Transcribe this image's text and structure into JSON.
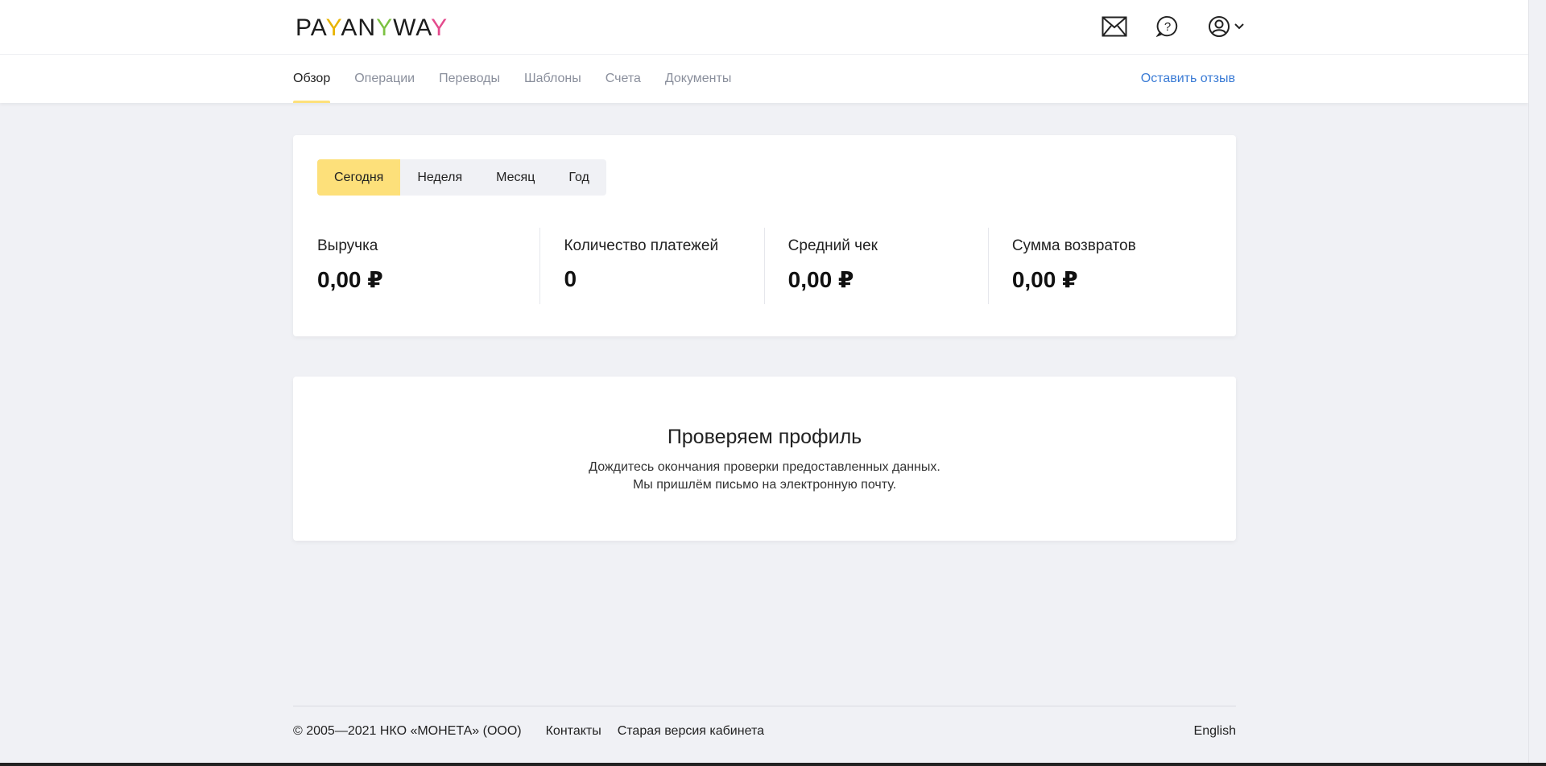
{
  "logo": {
    "part1": "PA",
    "y1": "Y",
    "part2": "AN",
    "y2": "Y",
    "part3": "WA",
    "y3": "Y"
  },
  "header_icons": [
    "mail-icon",
    "help-icon",
    "user-icon",
    "chevron-down-icon"
  ],
  "nav": {
    "items": [
      {
        "label": "Обзор",
        "active": true
      },
      {
        "label": "Операции"
      },
      {
        "label": "Переводы"
      },
      {
        "label": "Шаблоны"
      },
      {
        "label": "Счета"
      },
      {
        "label": "Документы"
      }
    ],
    "feedback": "Оставить отзыв"
  },
  "period_tabs": [
    {
      "label": "Сегодня",
      "active": true
    },
    {
      "label": "Неделя"
    },
    {
      "label": "Месяц"
    },
    {
      "label": "Год"
    }
  ],
  "metrics": [
    {
      "label": "Выручка",
      "value": "0,00 ₽"
    },
    {
      "label": "Количество платежей",
      "value": "0"
    },
    {
      "label": "Средний чек",
      "value": "0,00 ₽"
    },
    {
      "label": "Сумма возвратов",
      "value": "0,00 ₽"
    }
  ],
  "profile": {
    "title": "Проверяем профиль",
    "line1": "Дождитесь окончания проверки предоставленных данных.",
    "line2": "Мы пришлём письмо на электронную почту."
  },
  "footer": {
    "copyright": "© 2005—2021 НКО «МОНЕТА» (ООО)",
    "contacts": "Контакты",
    "old_version": "Старая версия кабинета",
    "language": "English"
  },
  "colors": {
    "accent_yellow": "#fde07a",
    "link_blue": "#3a7bd5",
    "background": "#f0f1f5"
  }
}
